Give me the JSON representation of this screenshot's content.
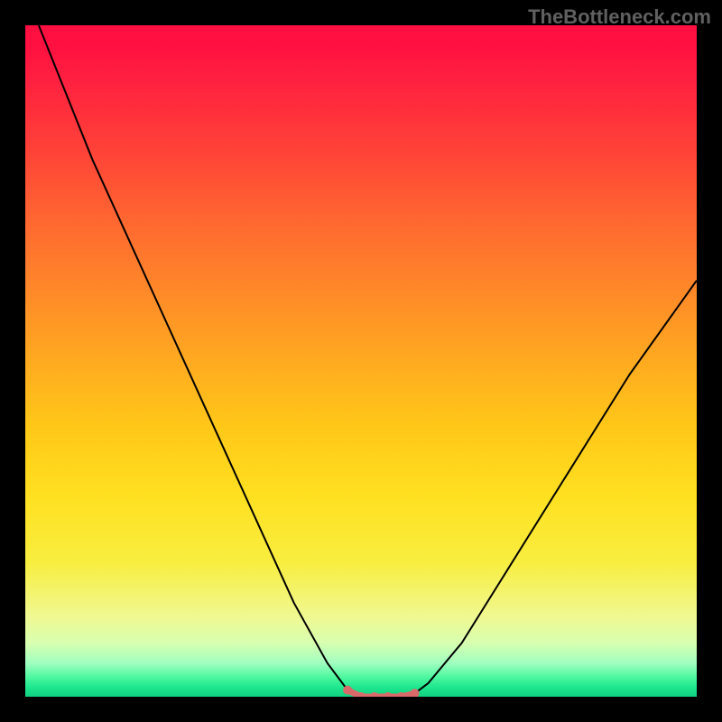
{
  "watermark": "TheBottleneck.com",
  "chart_data": {
    "type": "line",
    "title": "",
    "xlabel": "",
    "ylabel": "",
    "xlim": [
      0,
      100
    ],
    "ylim": [
      0,
      100
    ],
    "series": [
      {
        "name": "bottleneck-curve",
        "x": [
          2,
          10,
          20,
          30,
          40,
          45,
          48,
          50,
          52,
          54,
          56,
          58,
          60,
          65,
          70,
          80,
          90,
          100
        ],
        "y": [
          100,
          80,
          58,
          36,
          14,
          5,
          1,
          0,
          0,
          0,
          0,
          0.5,
          2,
          8,
          16,
          32,
          48,
          62
        ]
      }
    ],
    "highlight_region": {
      "x": [
        48,
        50,
        52,
        54,
        56,
        58
      ],
      "y": [
        1,
        0,
        0,
        0,
        0,
        0.5
      ],
      "color": "#d96a6a"
    },
    "gradient_stops": [
      {
        "pos": 0,
        "color": "#ff1040"
      },
      {
        "pos": 50,
        "color": "#ffaa20"
      },
      {
        "pos": 90,
        "color": "#f0f890"
      },
      {
        "pos": 100,
        "color": "#10d080"
      }
    ]
  }
}
